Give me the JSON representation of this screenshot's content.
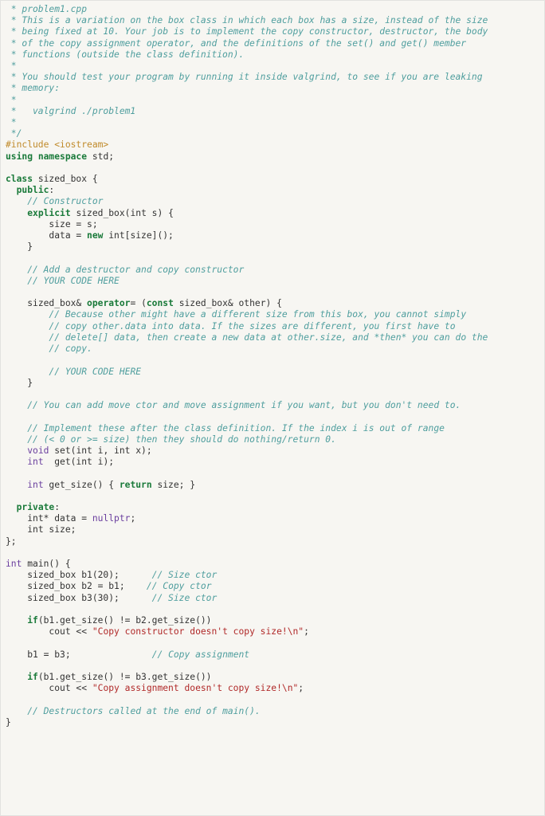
{
  "filename": "problem1.cpp",
  "comment_block": [
    " * problem1.cpp",
    " * This is a variation on the box class in which each box has a size, instead of the size",
    " * being fixed at 10. Your job is to implement the copy constructor, destructor, the body",
    " * of the copy assignment operator, and the definitions of the set() and get() member",
    " * functions (outside the class definition).",
    " *",
    " * You should test your program by running it inside valgrind, to see if you are leaking",
    " * memory:",
    " *",
    " *   valgrind ./problem1",
    " *",
    " */"
  ],
  "include": "#include <iostream>",
  "using_ns": {
    "using": "using",
    "namespace": "namespace",
    "std": "std"
  },
  "class_decl": {
    "class": "class",
    "name": "sized_box"
  },
  "labels": {
    "public": "public",
    "private": "private",
    "constructor_comment": "// Constructor",
    "explicit": "explicit",
    "ctor_sig": "sized_box(int s) {",
    "ctor_l1": "size = s;",
    "ctor_l2_a": "data = ",
    "ctor_l2_new": "new",
    "ctor_l2_b": " int[size]();",
    "add_dtor_comment1": "// Add a destructor and copy constructor",
    "add_dtor_comment2": "// YOUR CODE HERE",
    "op_assign_a": "sized_box& ",
    "op_assign_kw": "operator",
    "op_assign_b": "= (",
    "op_assign_const": "const",
    "op_assign_c": " sized_box& other) {",
    "op_c1": "// Because other might have a different size from this box, you cannot simply",
    "op_c2": "// copy other.data into data. If the sizes are different, you first have to",
    "op_c3": "// delete[] data, then create a new data at other.size, and *then* you can do the",
    "op_c4": "// copy.",
    "op_c5": "// YOUR CODE HERE",
    "move_comment": "// You can add move ctor and move assignment if you want, but you don't need to.",
    "impl_comment1": "// Implement these after the class definition. If the index i is out of range",
    "impl_comment2": "// (< 0 or >= size) then they should do nothing/return 0.",
    "set_sig_a": "void",
    "set_sig_b": " set(int i, int x);",
    "get_sig_a": "int",
    "get_sig_b": "  get(int i);",
    "getsize_a": "int",
    "getsize_b": " get_size() { ",
    "return": "return",
    "getsize_c": " size; }",
    "priv_data_a": "int* data = ",
    "nullptr": "nullptr",
    "priv_size": "int size;",
    "main_sig_a": "int",
    "main_sig_b": " main() {",
    "m_l1_a": "sized_box b1(20);",
    "m_l1_c": "// Size ctor",
    "m_l2_a": "sized_box b2 = b1;",
    "m_l2_c": "// Copy ctor",
    "m_l3_a": "sized_box b3(30);",
    "m_l3_c": "// Size ctor",
    "if1_a": "if",
    "if1_b": "(b1.get_size() != b2.get_size())",
    "cout1_a": "cout << ",
    "str1": "\"Copy constructor doesn't copy size!\\n\"",
    "semicolon": ";",
    "assign_l": "b1 = b3;",
    "assign_c": "// Copy assignment",
    "if2_b": "(b1.get_size() != b3.get_size())",
    "str2": "\"Copy assignment doesn't copy size!\\n\"",
    "end_c": "// Destructors called at the end of main().",
    "close_brace": "}"
  }
}
